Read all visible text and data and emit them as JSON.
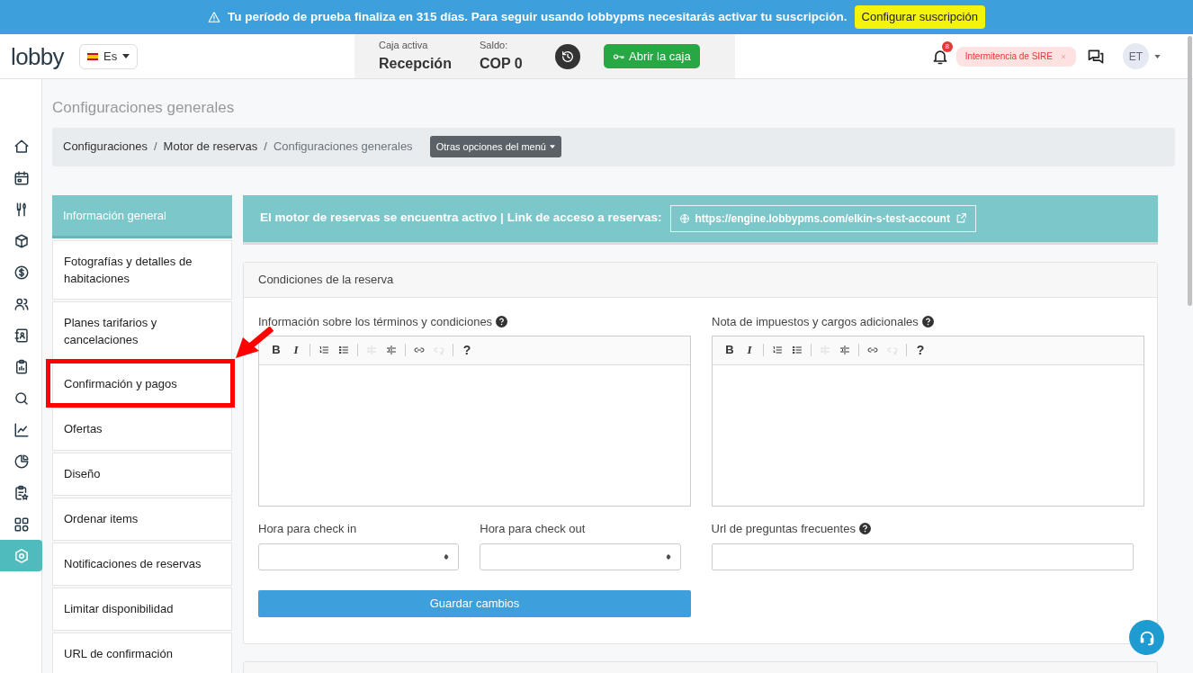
{
  "trial_banner": {
    "message": "Tu período de prueba finaliza en 315 días. Para seguir usando lobbypms necesitarás activar tu suscripción.",
    "button": "Configurar suscripción"
  },
  "header": {
    "logo": "lobby",
    "language": "Es",
    "cash": {
      "label": "Caja activa",
      "value": "Recepción"
    },
    "balance": {
      "label": "Saldo:",
      "value": "COP 0"
    },
    "open_button": "Abrir la caja",
    "notification_count": "8",
    "alert_chip": "Intermitencia de SIRE",
    "avatar": "ET"
  },
  "rail": [
    {
      "kind": "home",
      "selected": false
    },
    {
      "kind": "calendar",
      "selected": false
    },
    {
      "kind": "utensils",
      "selected": false
    },
    {
      "kind": "box",
      "selected": false
    },
    {
      "kind": "dollar",
      "selected": false
    },
    {
      "kind": "users",
      "selected": false
    },
    {
      "kind": "contacts",
      "selected": false
    },
    {
      "kind": "clipboard",
      "selected": false
    },
    {
      "kind": "search",
      "selected": false
    },
    {
      "kind": "chart",
      "selected": false
    },
    {
      "kind": "pie",
      "selected": false
    },
    {
      "kind": "clipstar",
      "selected": false
    },
    {
      "kind": "grid",
      "selected": false
    },
    {
      "kind": "gear",
      "selected": true
    }
  ],
  "page_title": "Configuraciones generales",
  "breadcrumb": [
    {
      "label": "Configuraciones"
    },
    {
      "separator": "/",
      "label": "Motor de reservas"
    },
    {
      "separator": "/",
      "label": "Configuraciones generales"
    }
  ],
  "menu_button": "Otras opciones del menú",
  "side_menu": [
    {
      "label": "Información general",
      "selected": true,
      "highlighted": false
    },
    {
      "label": "Fotografías y detalles de habitaciones",
      "selected": false,
      "highlighted": false
    },
    {
      "label": "Planes tarifarios y cancelaciones",
      "selected": false,
      "highlighted": false
    },
    {
      "label": "Confirmación y pagos",
      "selected": false,
      "highlighted": true
    },
    {
      "label": "Ofertas",
      "selected": false,
      "highlighted": false
    },
    {
      "label": "Diseño",
      "selected": false,
      "highlighted": false
    },
    {
      "label": "Ordenar items",
      "selected": false,
      "highlighted": false
    },
    {
      "label": "Notificaciones de reservas",
      "selected": false,
      "highlighted": false
    },
    {
      "label": "Limitar disponibilidad",
      "selected": false,
      "highlighted": false
    },
    {
      "label": "URL de confirmación",
      "selected": false,
      "highlighted": false
    }
  ],
  "engine_banner": {
    "text": "El motor de reservas se encuentra activo | Link de acceso a reservas:",
    "link": "https://engine.lobbypms.com/elkin-s-test-account"
  },
  "card": {
    "title": "Condiciones de la reserva",
    "editors": [
      {
        "label": "Información sobre los términos y condiciones",
        "toolbar": [
          {
            "kind": "bold",
            "label": "B",
            "disabled": false
          },
          {
            "kind": "italic",
            "label": "I",
            "disabled": false
          },
          {
            "kind": "sep"
          },
          {
            "kind": "ol",
            "disabled": false
          },
          {
            "kind": "ul",
            "disabled": false
          },
          {
            "kind": "sep"
          },
          {
            "kind": "outdent",
            "disabled": true
          },
          {
            "kind": "indent",
            "disabled": false
          },
          {
            "kind": "sep"
          },
          {
            "kind": "link",
            "disabled": false
          },
          {
            "kind": "unlink",
            "disabled": true
          },
          {
            "kind": "sep"
          },
          {
            "kind": "help",
            "label": "?",
            "disabled": false
          }
        ]
      },
      {
        "label": "Nota de impuestos y cargos adicionales",
        "toolbar": [
          {
            "kind": "bold",
            "label": "B",
            "disabled": false
          },
          {
            "kind": "italic",
            "label": "I",
            "disabled": false
          },
          {
            "kind": "sep"
          },
          {
            "kind": "ol",
            "disabled": false
          },
          {
            "kind": "ul",
            "disabled": false
          },
          {
            "kind": "sep"
          },
          {
            "kind": "outdent",
            "disabled": true
          },
          {
            "kind": "indent",
            "disabled": false
          },
          {
            "kind": "sep"
          },
          {
            "kind": "link",
            "disabled": false
          },
          {
            "kind": "unlink",
            "disabled": true
          },
          {
            "kind": "sep"
          },
          {
            "kind": "help",
            "label": "?",
            "disabled": false
          }
        ]
      }
    ],
    "checkin_label": "Hora para check in",
    "checkout_label": "Hora para check out",
    "faq_label": "Url de preguntas frecuentes",
    "save_button": "Guardar cambios"
  }
}
